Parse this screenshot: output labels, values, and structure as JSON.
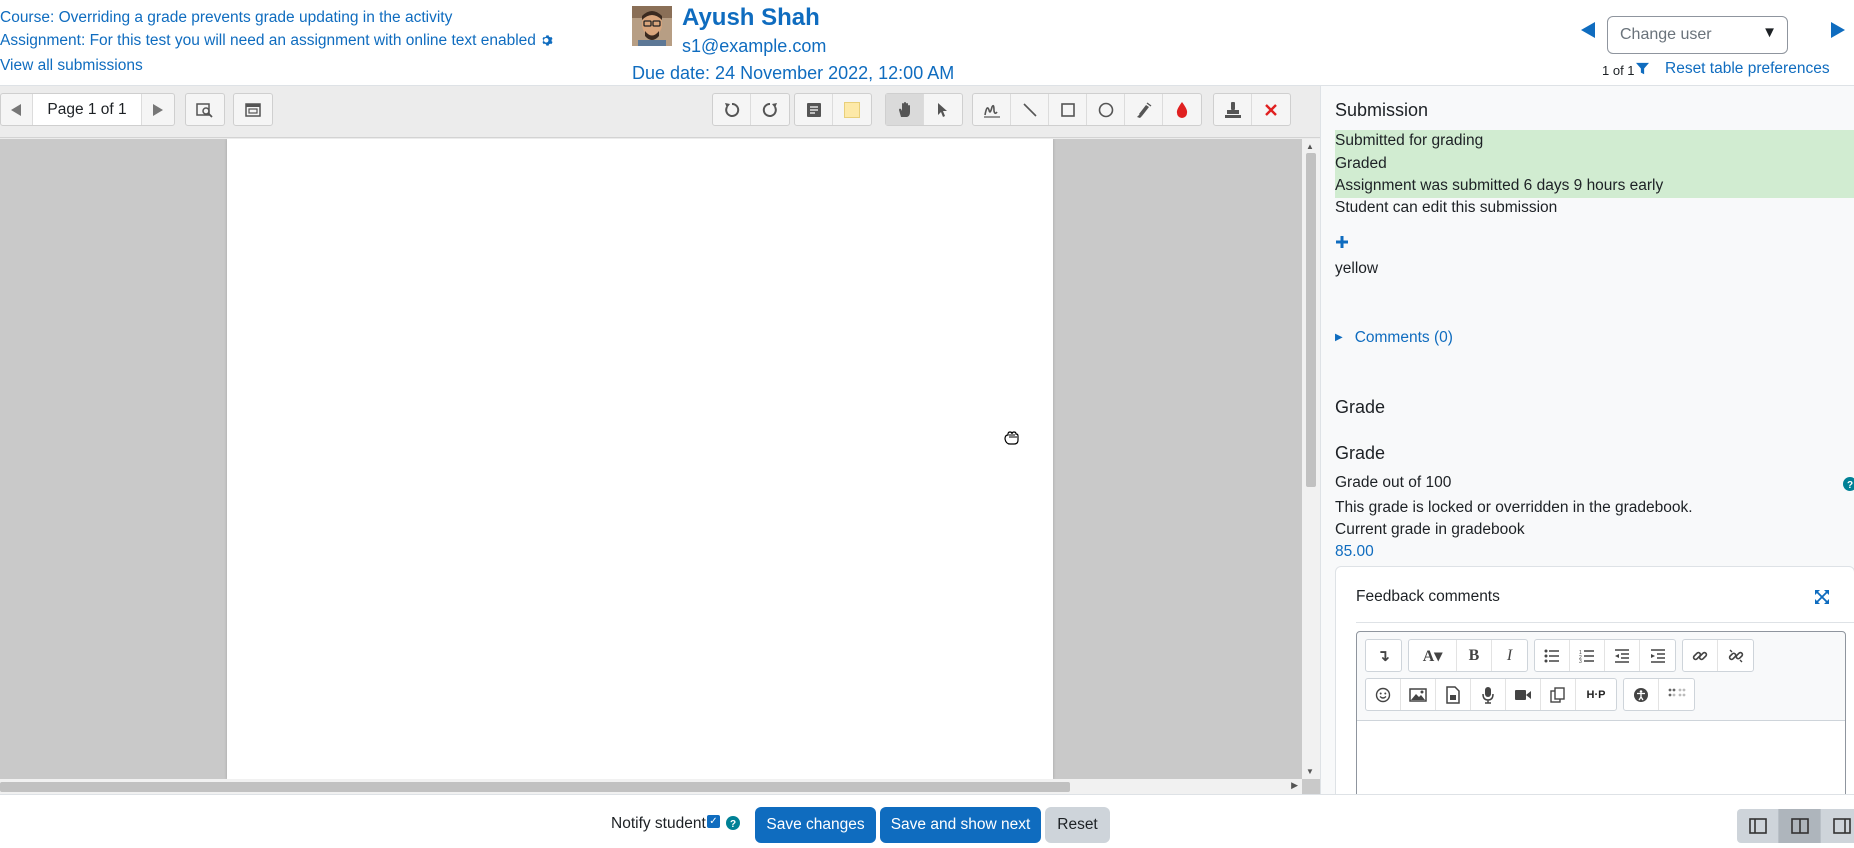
{
  "header": {
    "course_link": "Course: Overriding a grade prevents grade updating in the activity",
    "assignment_link": "Assignment: For this test you will need an assignment with online text enabled",
    "view_all_link": "View all submissions",
    "user_name": "Ayush Shah",
    "user_email": "s1@example.com",
    "due_date": "Due date: 24 November 2022, 12:00 AM",
    "change_user_placeholder": "Change user",
    "user_count": "1 of 1",
    "reset_table_link": "Reset table preferences"
  },
  "pdf_toolbar": {
    "page_label": "Page 1 of 1"
  },
  "submission": {
    "heading": "Submission",
    "status_lines": [
      "Submitted for grading",
      "Graded",
      "Assignment was submitted 6 days 9 hours early"
    ],
    "edit_status": "Student can edit this submission",
    "tag": "yellow",
    "comments_link": "Comments (0)"
  },
  "grade": {
    "heading": "Grade",
    "subheading": "Grade",
    "grade_out_of": "Grade out of 100",
    "locked_message": "This grade is locked or overridden in the gradebook.",
    "current_grade_label": "Current grade in gradebook",
    "current_grade_value": "85.00",
    "feedback_title": "Feedback comments"
  },
  "footer": {
    "notify_label": "Notify student",
    "notify_checked": true,
    "save_label": "Save changes",
    "save_next_label": "Save and show next",
    "reset_label": "Reset"
  },
  "colors": {
    "link": "#0f6cbf",
    "status_bg": "#d1ecd1",
    "delete_annotation": "#e02020",
    "color_picker": "#e02020",
    "highlight_swatch": "#fde9a8"
  }
}
